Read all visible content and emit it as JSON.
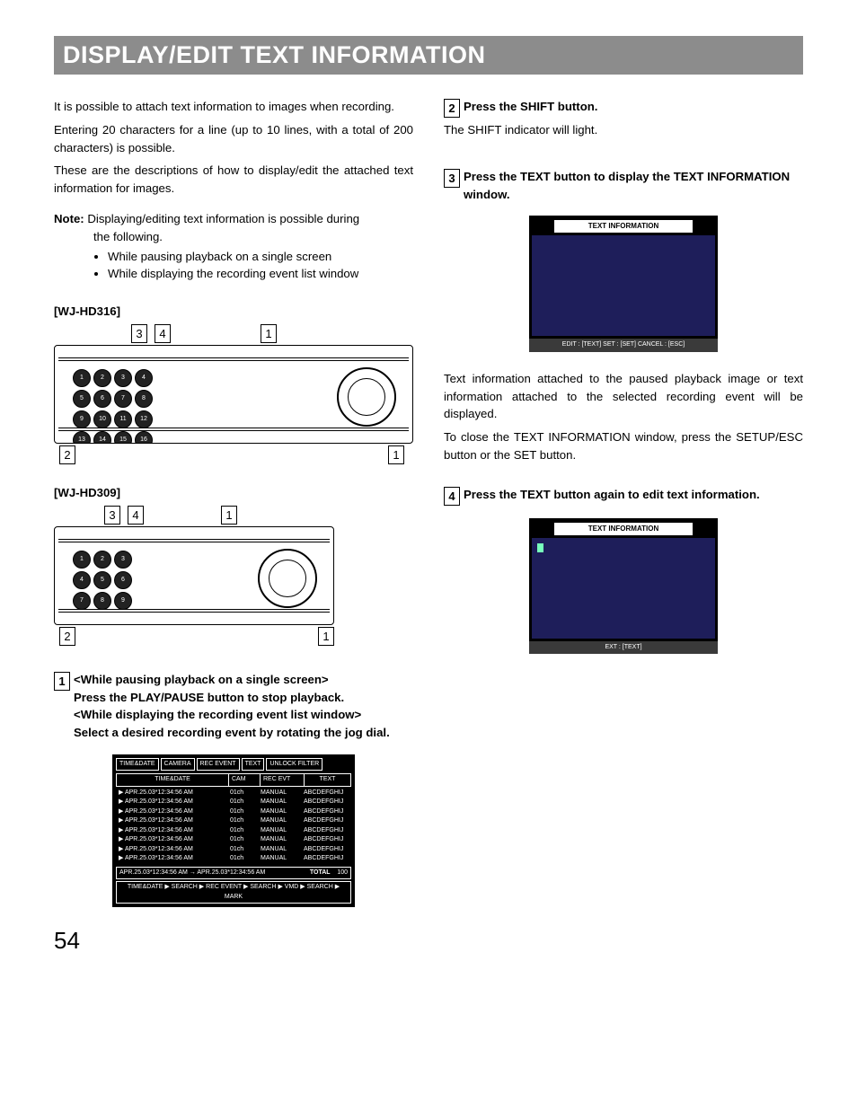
{
  "title": "DISPLAY/EDIT TEXT INFORMATION",
  "page_number": "54",
  "intro": {
    "p1": "It is possible to attach text information to images when recording.",
    "p2": "Entering 20 characters for a line (up to 10 lines, with a total of 200 characters) is possible.",
    "p3": "These are the descriptions of how to display/edit the attached text information for images."
  },
  "note": {
    "label": "Note:",
    "text_a": "Displaying/editing text information is possible during",
    "text_b": "the following.",
    "bullets": [
      "While pausing playback on a single screen",
      "While displaying the recording event list window"
    ]
  },
  "models": {
    "m1": "[WJ-HD316]",
    "m2": "[WJ-HD309]"
  },
  "callouts": {
    "n1": "1",
    "n2": "2",
    "n3": "3",
    "n4": "4"
  },
  "step1": {
    "num": "1",
    "l1": "<While pausing playback on a single screen>",
    "l2": "Press the PLAY/PAUSE button to stop playback.",
    "l3": "<While displaying the recording event list window>",
    "l4": "Select a desired recording event by rotating the jog dial."
  },
  "event_table": {
    "tabs": [
      "TIME&DATE",
      "CAMERA",
      "REC EVENT",
      "TEXT",
      "UNLOCK FILTER"
    ],
    "headers": {
      "td": "TIME&DATE",
      "cam": "CAM",
      "evt": "REC EVT",
      "txt": "TEXT"
    },
    "rows": [
      {
        "td": "▶ APR.25.03*12:34:56 AM",
        "cam": "01ch",
        "evt": "MANUAL",
        "txt": "ABCDEFGHIJ"
      },
      {
        "td": "▶ APR.25.03*12:34:56 AM",
        "cam": "01ch",
        "evt": "MANUAL",
        "txt": "ABCDEFGHIJ"
      },
      {
        "td": "▶ APR.25.03*12:34:56 AM",
        "cam": "01ch",
        "evt": "MANUAL",
        "txt": "ABCDEFGHIJ"
      },
      {
        "td": "▶ APR.25.03*12:34:56 AM",
        "cam": "01ch",
        "evt": "MANUAL",
        "txt": "ABCDEFGHIJ"
      },
      {
        "td": "▶ APR.25.03*12:34:56 AM",
        "cam": "01ch",
        "evt": "MANUAL",
        "txt": "ABCDEFGHIJ"
      },
      {
        "td": "▶ APR.25.03*12:34:56 AM",
        "cam": "01ch",
        "evt": "MANUAL",
        "txt": "ABCDEFGHIJ"
      },
      {
        "td": "▶ APR.25.03*12:34:56 AM",
        "cam": "01ch",
        "evt": "MANUAL",
        "txt": "ABCDEFGHIJ"
      },
      {
        "td": "▶ APR.25.03*12:34:56 AM",
        "cam": "01ch",
        "evt": "MANUAL",
        "txt": "ABCDEFGHIJ"
      }
    ],
    "footer_range": "APR.25.03*12:34:56 AM → APR.25.03*12:34:56 AM",
    "footer_total_label": "TOTAL",
    "footer_total_value": "100",
    "crumb": "TIME&DATE ▶ SEARCH ▶ REC EVENT ▶ SEARCH ▶ VMD ▶ SEARCH ▶ MARK"
  },
  "step2": {
    "num": "2",
    "head": "Press the SHIFT button.",
    "body": "The SHIFT indicator will light."
  },
  "step3": {
    "num": "3",
    "head": "Press the TEXT button to display the TEXT INFORMATION window.",
    "fig_title": "TEXT INFORMATION",
    "fig_footer": "EDIT : [TEXT]   SET : [SET]   CANCEL : [ESC]",
    "body1": "Text information attached to the paused playback image or text information attached to the selected recording event will be displayed.",
    "body2": "To close the TEXT INFORMATION window, press the SETUP/ESC button or the SET button."
  },
  "step4": {
    "num": "4",
    "head": "Press the TEXT button again to edit text information.",
    "fig_title": "TEXT INFORMATION",
    "fig_footer": "EXT : [TEXT]"
  }
}
